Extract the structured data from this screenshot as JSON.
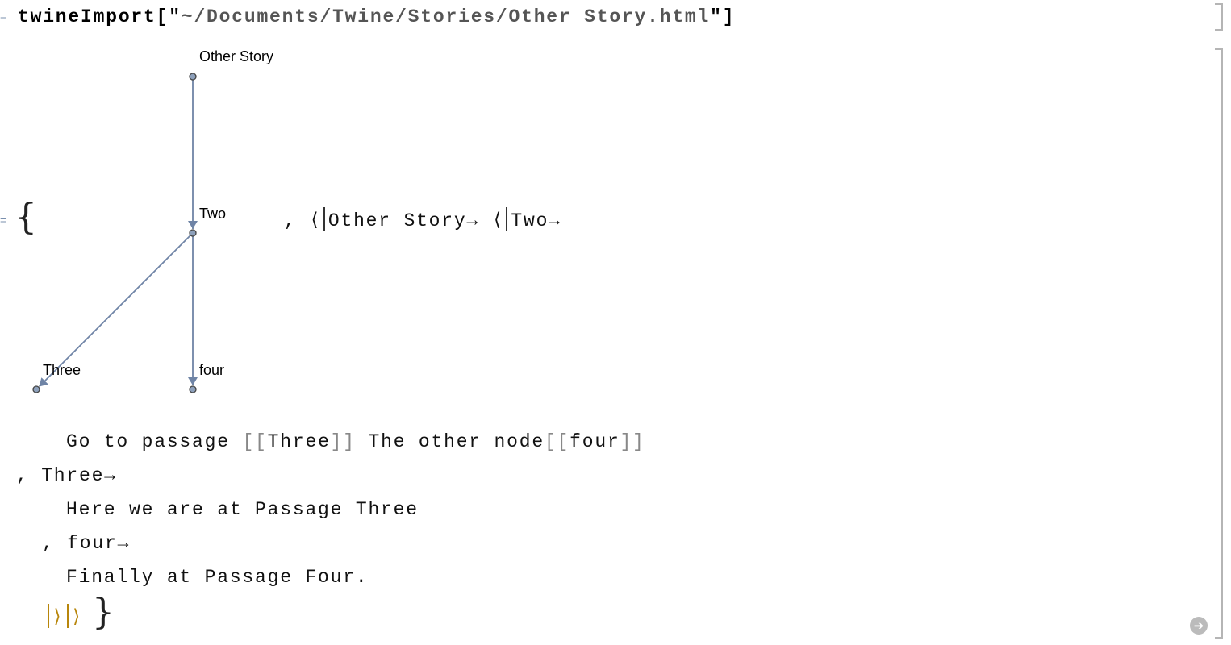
{
  "input": {
    "function": "twineImport",
    "open": "[\"",
    "path": "~/Documents/Twine/Stories/Other Story.html",
    "close": "\"]"
  },
  "graph": {
    "nodes": [
      {
        "label": "Other Story"
      },
      {
        "label": "Two"
      },
      {
        "label": "Three"
      },
      {
        "label": "four"
      }
    ],
    "edges": [
      [
        "Other Story",
        "Two"
      ],
      [
        "Two",
        "Three"
      ],
      [
        "Two",
        "four"
      ]
    ],
    "edge_color": "#6f84a6",
    "node_color": "#8da0bb"
  },
  "output": {
    "open_brace": "{",
    "assoc_line": ", ⟨",
    "key1": "Other Story",
    "arrow": "→",
    "assoc2": "⟨",
    "key2": "Two",
    "passage_two": "Go to passage ",
    "link_three": "Three",
    "passage_two_mid": " The other node",
    "link_four": "four",
    "bracket_open": "[[",
    "bracket_close": "]]",
    "key3": ", Three",
    "passage_three": "Here we are at Passage Three",
    "key4": ", four",
    "passage_four": "Finally at Passage Four.",
    "close_assoc": "⟩",
    "close_brace": "}"
  },
  "cell_markers": {
    "input": "=",
    "output": "="
  }
}
